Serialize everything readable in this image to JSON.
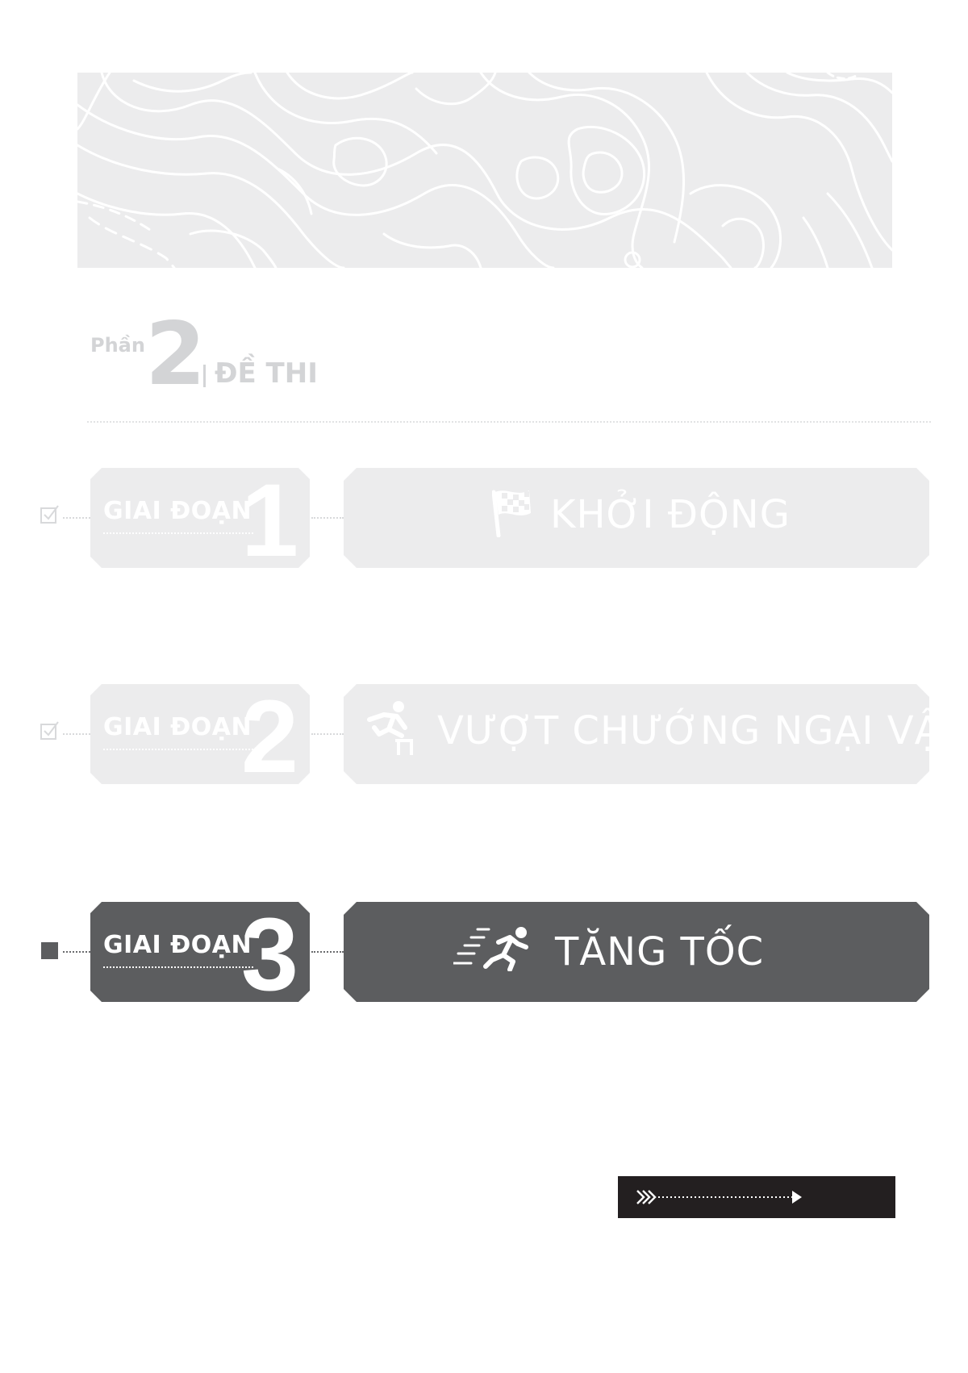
{
  "part": {
    "label": "Phần",
    "number": "2",
    "title": "ĐỀ THI"
  },
  "stages": [
    {
      "label": "GIAI ĐOẠN",
      "number": "1",
      "title": "KHỞI ĐỘNG",
      "icon": "checkered-flag-icon",
      "status": "done"
    },
    {
      "label": "GIAI ĐOẠN",
      "number": "2",
      "title": "VƯỢT CHƯỚNG NGẠI VẬT",
      "icon": "hurdle-jumper-icon",
      "status": "done"
    },
    {
      "label": "GIAI ĐOẠN",
      "number": "3",
      "title": "TĂNG TỐC",
      "icon": "sprinting-runner-icon",
      "status": "active"
    }
  ],
  "colors": {
    "done_fill": "#ececed",
    "active_fill": "#5c5d5f",
    "next_bar": "#231f20",
    "part_text": "#d3d4d6"
  },
  "next_icon": "arrow-right-icon"
}
